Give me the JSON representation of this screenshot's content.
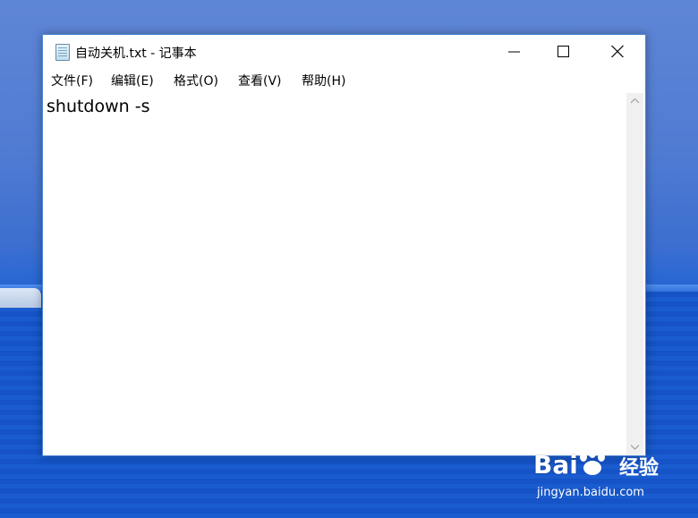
{
  "window": {
    "title": "自动关机.txt - 记事本",
    "app_icon": "notepad-icon",
    "caption_icons": [
      "minimize-icon",
      "maximize-icon",
      "close-icon"
    ]
  },
  "menu": {
    "file": "文件(F)",
    "edit": "编辑(E)",
    "format": "格式(O)",
    "view": "查看(V)",
    "help": "帮助(H)"
  },
  "editor": {
    "content": "shutdown -s"
  },
  "watermark": {
    "brand": "Bai",
    "brand2": "经验",
    "url": "jingyan.baidu.com"
  },
  "colors": {
    "window_border": "#4a86d8",
    "desktop_sky": "#4f7bd2",
    "desktop_sea": "#1553c6"
  }
}
